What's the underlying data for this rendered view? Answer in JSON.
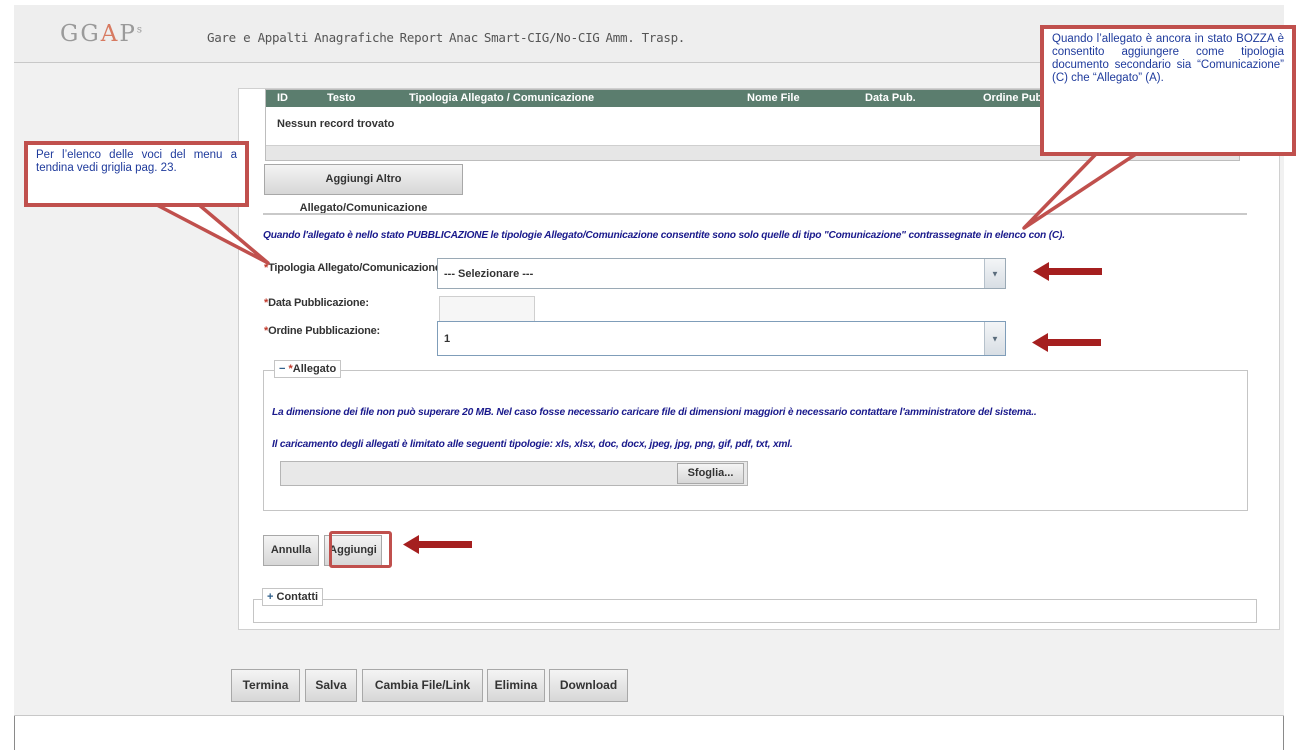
{
  "logo": {
    "text": "GG",
    "a": "A",
    "p": "P",
    "sup": "s"
  },
  "nav": [
    "Gare e Appalti",
    "Anagrafiche",
    "Report",
    "Anac",
    "Smart-CIG/No-CIG",
    "Amm. Trasp."
  ],
  "grid": {
    "columns": [
      "ID",
      "Testo",
      "Tipologia Allegato / Comunicazione",
      "Nome File",
      "Data Pub.",
      "Ordine Pub"
    ],
    "empty_text": "Nessun record trovato"
  },
  "add_other_button": "Aggiungi Altro Allegato/Comunicazione",
  "publication_note": "Quando l'allegato è nello stato PUBBLICAZIONE le tipologie Allegato/Comunicazione consentite sono solo quelle di tipo \"Comunicazione\" contrassegnate in elenco con (C).",
  "form": {
    "required_mark": "*",
    "tipologia_label": "Tipologia Allegato/Comunicazione:",
    "tipologia_value": "--- Selezionare ---",
    "data_label": "Data Pubblicazione:",
    "data_value": "",
    "ordine_label": "Ordine Pubblicazione:",
    "ordine_value": "1"
  },
  "allegato": {
    "toggle": "−",
    "legend": "Allegato",
    "size_info": "La dimensione dei file non può superare 20 MB. Nel caso fosse necessario caricare file di dimensioni maggiori è necessario contattare l'amministratore del sistema..",
    "types_info": "Il caricamento degli allegati è limitato alle seguenti tipologie: xls, xlsx, doc, docx, jpeg, jpg, png, gif, pdf, txt, xml.",
    "browse_button": "Sfoglia..."
  },
  "actions": {
    "cancel": "Annulla",
    "add": "Aggiungi"
  },
  "contatti": {
    "toggle": "+",
    "legend": "Contatti"
  },
  "bottom_buttons": [
    "Termina",
    "Salva",
    "Cambia File/Link",
    "Elimina",
    "Download"
  ],
  "callouts": {
    "left": "Per l’elenco delle voci del menu a tendina vedi griglia pag. 23.",
    "right": "Quando l’allegato è ancora in stato BOZZA è consentito aggiungere come tipologia documento secondario sia “Comunicazione” (C) che “Allegato” (A)."
  },
  "colors": {
    "grid_header": "#5b7d6e",
    "callout_border": "#c0504d",
    "callout_text": "#1f3b9c",
    "note_blue": "#1a1a8c",
    "arrow": "#a51f1f"
  }
}
